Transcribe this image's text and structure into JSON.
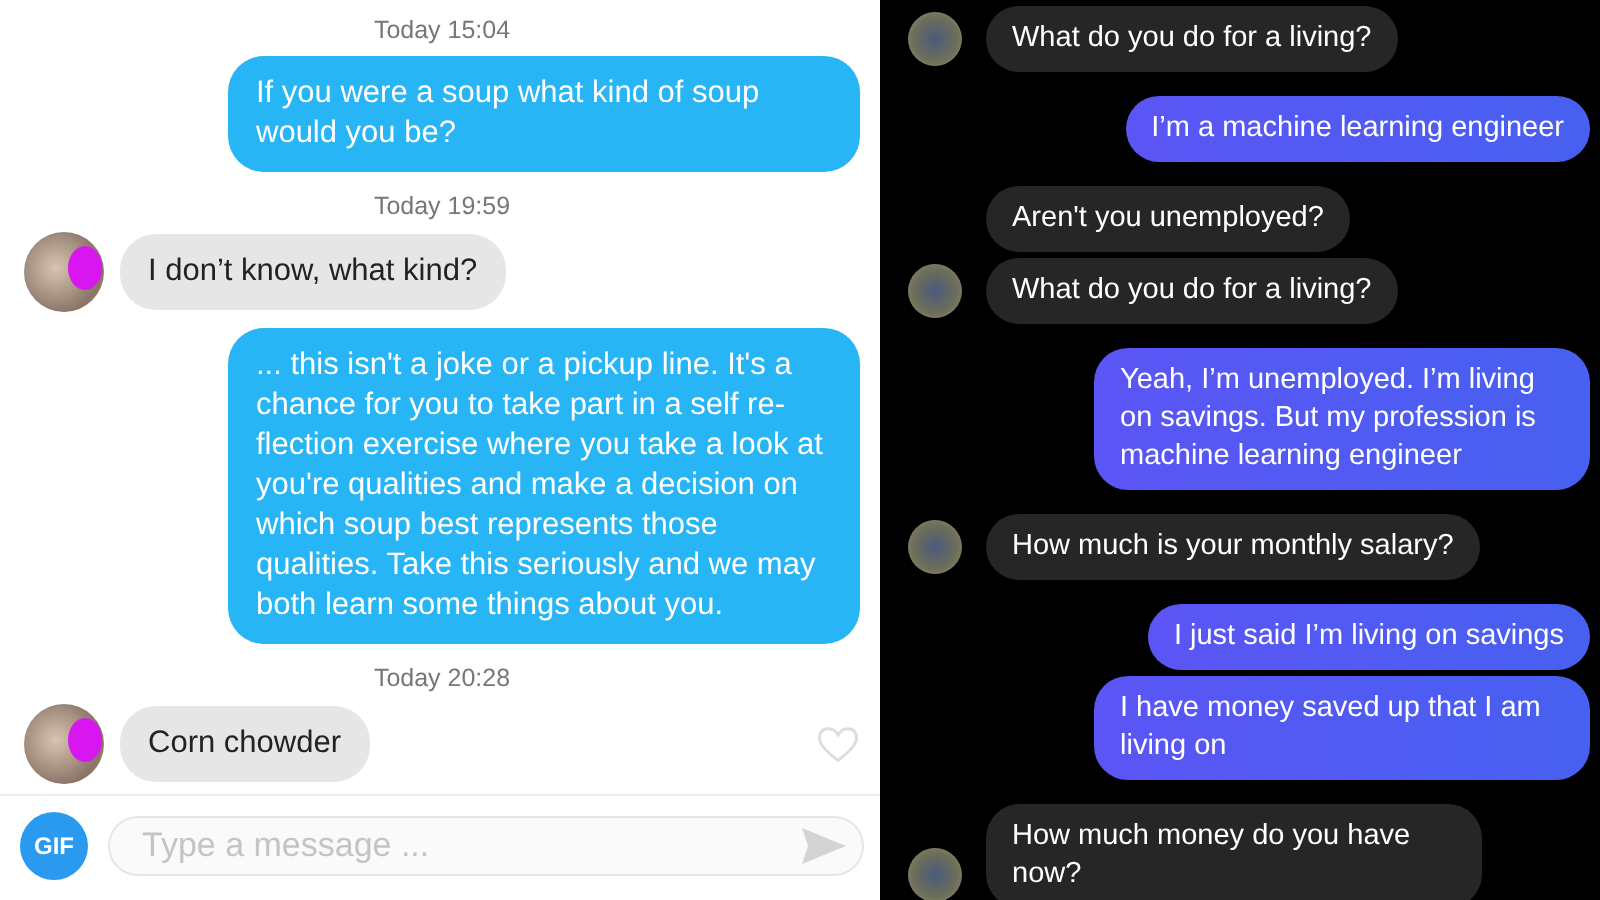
{
  "left_chat": {
    "messages": [
      {
        "kind": "time",
        "text": "Today 15:04"
      },
      {
        "kind": "out",
        "text": "If you were a soup what kind of soup would you be?"
      },
      {
        "kind": "time",
        "text": "Today 19:59"
      },
      {
        "kind": "in",
        "text": "I don’t know, what kind?",
        "avatar": true
      },
      {
        "kind": "out",
        "text": "... this isn't a joke or a pickup line. It's a chance for you to take part in a self re-flection exercise where you take a look at you're qualities and make a decision on which soup best represents those qualities. Take this seriously and we may both learn some things about you."
      },
      {
        "kind": "time",
        "text": "Today 20:28"
      },
      {
        "kind": "in",
        "text": "Corn chowder",
        "avatar": true
      }
    ],
    "composer": {
      "gif_label": "GIF",
      "placeholder": "Type a message ..."
    }
  },
  "right_chat": {
    "messages": [
      {
        "kind": "in",
        "text": "What do you do for a living?",
        "avatar": true
      },
      {
        "kind": "out",
        "text": "I’m a machine learning engineer"
      },
      {
        "kind": "in",
        "text": "Aren't you unemployed?",
        "avatar": false
      },
      {
        "kind": "in",
        "text": "What do you do for a living?",
        "avatar": true
      },
      {
        "kind": "out",
        "text": "Yeah, I’m unemployed. I’m living on savings. But my profession is machine learning engineer"
      },
      {
        "kind": "in",
        "text": "How much is your monthly salary?",
        "avatar": true
      },
      {
        "kind": "out",
        "text": "I just said I’m living on savings"
      },
      {
        "kind": "out",
        "text": "I have money saved up that I am living on"
      },
      {
        "kind": "in",
        "text": "How much money do you have now?",
        "avatar": true
      }
    ]
  }
}
